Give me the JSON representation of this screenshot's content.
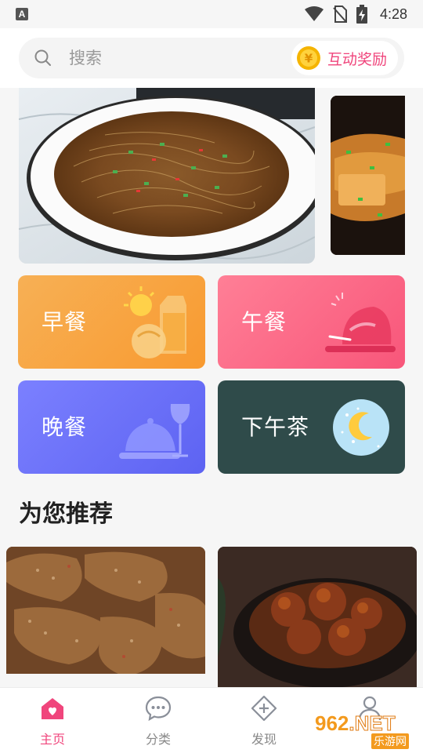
{
  "status_bar": {
    "app_indicator": "A",
    "time": "4:28",
    "icons": [
      "wifi-icon",
      "no-sim-icon",
      "battery-charging-icon"
    ]
  },
  "search": {
    "placeholder": "搜索",
    "reward_label": "互动奖励",
    "reward_coin_glyph": "¥"
  },
  "banners": [
    {
      "name": "vermicelli-dish",
      "caption": ""
    },
    {
      "name": "tofu-dish",
      "caption": ""
    }
  ],
  "meal_categories": [
    {
      "label": "早餐",
      "icon": "breakfast-illustration",
      "color": "#f89a30"
    },
    {
      "label": "午餐",
      "icon": "lunch-illustration",
      "color": "#f8567a"
    },
    {
      "label": "晚餐",
      "icon": "dinner-illustration",
      "color": "#5d63f2"
    },
    {
      "label": "下午茶",
      "icon": "afternoon-tea-illustration",
      "color": "#2f4b4a"
    }
  ],
  "recommend": {
    "title": "为您推荐",
    "items": [
      {
        "name": "fried-pork-dish"
      },
      {
        "name": "braised-meat-dish"
      }
    ]
  },
  "tab_bar": {
    "items": [
      {
        "label": "主页",
        "icon": "home-icon",
        "active": true
      },
      {
        "label": "分类",
        "icon": "chat-bubble-icon",
        "active": false
      },
      {
        "label": "发现",
        "icon": "compass-icon",
        "active": false
      },
      {
        "label": "",
        "icon": "user-icon",
        "active": false
      }
    ]
  },
  "watermark": {
    "logo_num": "962",
    "logo_suffix": ".NET",
    "sub_text": "乐游网"
  },
  "colors": {
    "accent": "#f0457c",
    "background": "#f6f6f6"
  }
}
